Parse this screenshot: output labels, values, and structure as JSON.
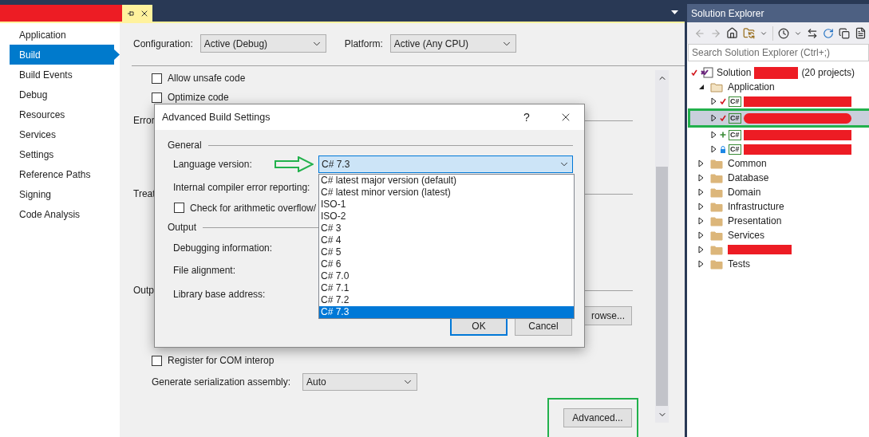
{
  "document_tab": {
    "redacted": true
  },
  "nav": [
    {
      "label": "Application",
      "selected": false
    },
    {
      "label": "Build",
      "selected": true
    },
    {
      "label": "Build Events",
      "selected": false
    },
    {
      "label": "Debug",
      "selected": false
    },
    {
      "label": "Resources",
      "selected": false
    },
    {
      "label": "Services",
      "selected": false
    },
    {
      "label": "Settings",
      "selected": false
    },
    {
      "label": "Reference Paths",
      "selected": false
    },
    {
      "label": "Signing",
      "selected": false
    },
    {
      "label": "Code Analysis",
      "selected": false
    }
  ],
  "configuration": {
    "label": "Configuration:",
    "value": "Active (Debug)"
  },
  "platform": {
    "label": "Platform:",
    "value": "Active (Any CPU)"
  },
  "build_rows": [
    {
      "kind": "checkbox",
      "label": "Allow unsafe code",
      "checked": false
    },
    {
      "kind": "checkbox",
      "label": "Optimize code",
      "checked": false
    },
    {
      "kind": "section",
      "label": "Error"
    },
    {
      "kind": "blank"
    },
    {
      "kind": "blank"
    },
    {
      "kind": "section",
      "label": "Treat"
    },
    {
      "kind": "blank"
    },
    {
      "kind": "blank"
    },
    {
      "kind": "blank"
    },
    {
      "kind": "section",
      "label": "Outp"
    },
    {
      "kind": "browse",
      "label": "rowse..."
    },
    {
      "kind": "blank"
    },
    {
      "kind": "checkbox",
      "label": "Register for COM interop",
      "checked": false
    },
    {
      "kind": "select",
      "label": "Generate serialization assembly:",
      "value": "Auto"
    }
  ],
  "advanced_button": {
    "label": "Advanced...",
    "highlighted": true
  },
  "dialog": {
    "title": "Advanced Build Settings",
    "help": "?",
    "general": {
      "title": "General",
      "language": {
        "label": "Language version:",
        "value": "C# 7.3",
        "pointer_arrow": true,
        "options": [
          {
            "label": "C# latest major version (default)",
            "selected": false
          },
          {
            "label": "C# latest minor version (latest)",
            "selected": false
          },
          {
            "label": "ISO-1",
            "selected": false
          },
          {
            "label": "ISO-2",
            "selected": false
          },
          {
            "label": "C# 3",
            "selected": false
          },
          {
            "label": "C# 4",
            "selected": false
          },
          {
            "label": "C# 5",
            "selected": false
          },
          {
            "label": "C# 6",
            "selected": false
          },
          {
            "label": "C# 7.0",
            "selected": false
          },
          {
            "label": "C# 7.1",
            "selected": false
          },
          {
            "label": "C# 7.2",
            "selected": false
          },
          {
            "label": "C# 7.3",
            "selected": true
          }
        ]
      },
      "error_reporting": {
        "label": "Internal compiler error reporting:"
      },
      "overflow": {
        "label": "Check for arithmetic overflow/",
        "checked": false
      }
    },
    "output": {
      "title": "Output",
      "fields": [
        "Debugging information:",
        "File alignment:",
        "Library base address:"
      ]
    },
    "buttons": [
      {
        "label": "OK",
        "default": true
      },
      {
        "label": "Cancel",
        "default": false
      }
    ]
  },
  "solution_explorer": {
    "title": "Solution Explorer",
    "search": {
      "placeholder": "Search Solution Explorer (Ctrl+;)"
    },
    "tree": [
      {
        "kind": "solution",
        "label": "Solution",
        "redacted": true,
        "suffix": "(20 projects)",
        "status": {
          "kind": "checked"
        },
        "children": [
          {
            "kind": "folder",
            "label": "Application",
            "expanded": true,
            "children": [
              {
                "kind": "project",
                "icon_label": "C#",
                "redacted": true,
                "status": {
                  "kind": "checked"
                },
                "selected": false,
                "highlighted": false
              },
              {
                "kind": "project",
                "icon_label": "C#",
                "redacted": true,
                "status": {
                  "kind": "checked"
                },
                "selected": true,
                "highlighted": true
              },
              {
                "kind": "project",
                "icon_label": "C#",
                "redacted": true,
                "status": {
                  "kind": "added"
                },
                "selected": false,
                "highlighted": false
              },
              {
                "kind": "project",
                "icon_label": "C#",
                "redacted": true,
                "status": {
                  "kind": "locked"
                },
                "selected": false,
                "highlighted": false
              }
            ]
          },
          {
            "kind": "folder",
            "label": "Common",
            "expanded": false
          },
          {
            "kind": "folder",
            "label": "Database",
            "expanded": false
          },
          {
            "kind": "folder",
            "label": "Domain",
            "expanded": false
          },
          {
            "kind": "folder",
            "label": "Infrastructure",
            "expanded": false
          },
          {
            "kind": "folder",
            "label": "Presentation",
            "expanded": false
          },
          {
            "kind": "folder",
            "label": "Services",
            "expanded": false
          },
          {
            "kind": "folder",
            "redacted": true,
            "expanded": false
          },
          {
            "kind": "folder",
            "label": "Tests",
            "expanded": false
          }
        ]
      }
    ]
  }
}
